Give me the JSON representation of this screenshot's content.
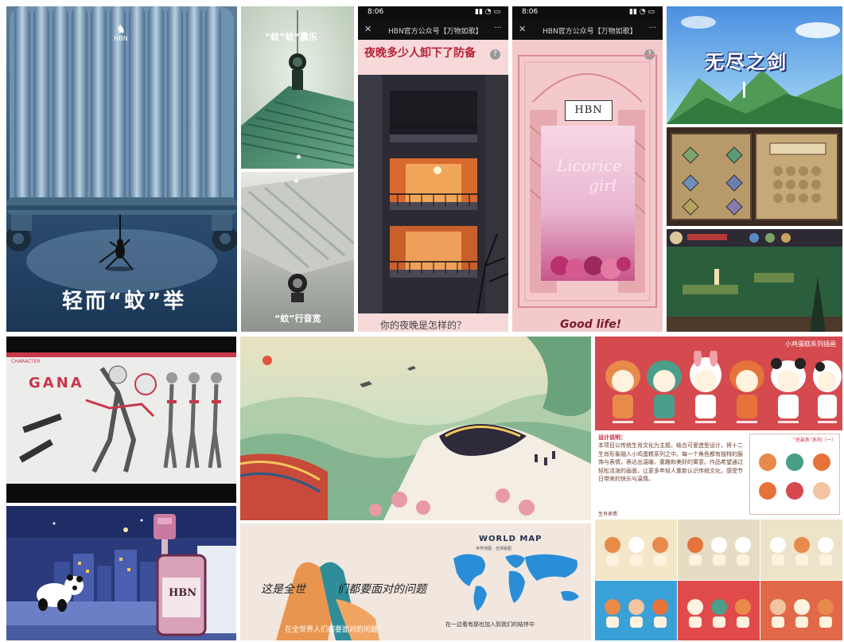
{
  "tiles": {
    "suitcase": {
      "brand": "HBN",
      "slogan": "轻而“蚊”举"
    },
    "green_ad": {
      "top_caption": "“蚊”蚊”震乐",
      "bottom_caption": "“蚊”行音宽"
    },
    "phone1": {
      "time": "8:06",
      "signal": "▮▮ ◔ ▭",
      "nav_title": "HBN官方公众号【万物如歌】",
      "close": "✕",
      "more": "···",
      "headline": "夜晚多少人卸下了防备",
      "help": "?",
      "bottom_text": "你的夜晚是怎样的？"
    },
    "phone2": {
      "time": "8:06",
      "signal": "▮▮ ◔ ▭",
      "nav_title": "HBN官方公众号【万物如歌】",
      "close": "✕",
      "more": "···",
      "help": "?",
      "logo": "HBN",
      "script_line1": "Licorice",
      "script_line2": "girl",
      "bottom_text": "Good life!"
    },
    "game": {
      "title": "无尽之剑"
    },
    "gana": {
      "title": "GANA",
      "header_tag": "CHARACTER"
    },
    "panda": {
      "bottle_label": "HBN"
    },
    "worldmap": {
      "title": "WORLD MAP",
      "subtitle": "世界地图 · 全球版图",
      "headline_left": "这是全世",
      "headline_right": "们都要面对的问题",
      "footer_left": "在全世界人们都要面对的问题",
      "footer_right": "在一边看有那也加入到我们的结伴中"
    },
    "zodiac": {
      "title": "小鸡蛋糕系列插画",
      "side_title": "“兄弟系”系列（一）",
      "paragraph_title": "设计说明：",
      "paragraph": "本项目以传统生肖文化为主题，结合可爱造型设计，将十二生肖形象融入小鸡蛋糕系列之中。每一个角色都有独特的服饰与表情，表达出温暖、童趣和美好的寓意。作品希望通过轻松活泼的画面，让更多年轻人重新认识传统文化，感受节日带来的快乐与温情。",
      "sub_label": "生肖表情"
    }
  }
}
